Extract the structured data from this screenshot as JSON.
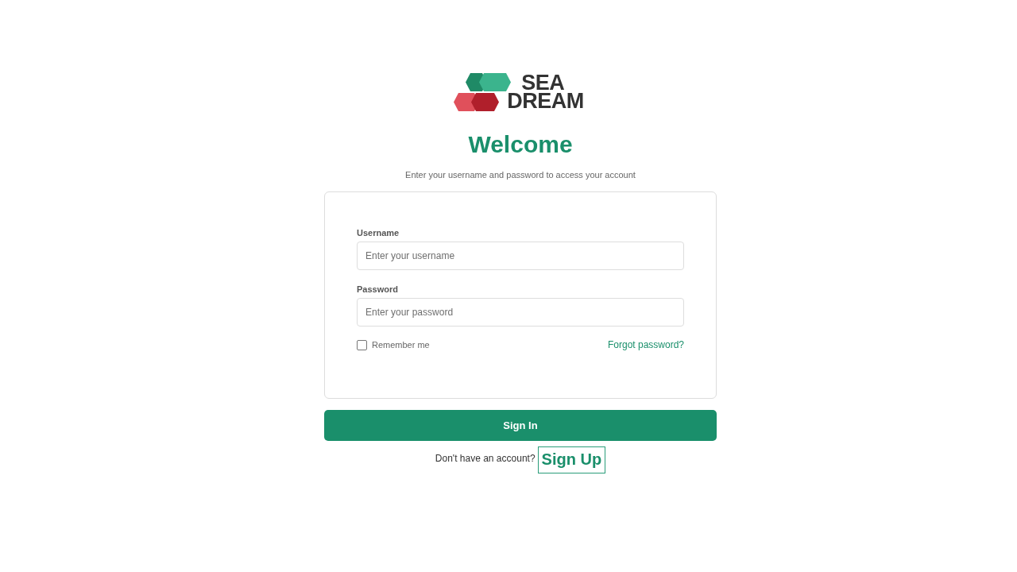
{
  "logo": {
    "lines": [
      "SEA",
      "DREAM"
    ]
  },
  "heading": "Welcome",
  "subtitle": "Enter your username and password to access your account",
  "form": {
    "fields": [
      {
        "label": "Username",
        "placeholder": "Enter your username"
      },
      {
        "label": "Password",
        "placeholder": "Enter your password"
      }
    ],
    "remember_me": {
      "label": "Remember me",
      "checked": false
    },
    "forgot_password": "Forgot password?"
  },
  "sign_in_button": "Sign In",
  "footer": {
    "prompt": "Don't have an account?",
    "link": "Sign Up"
  }
}
